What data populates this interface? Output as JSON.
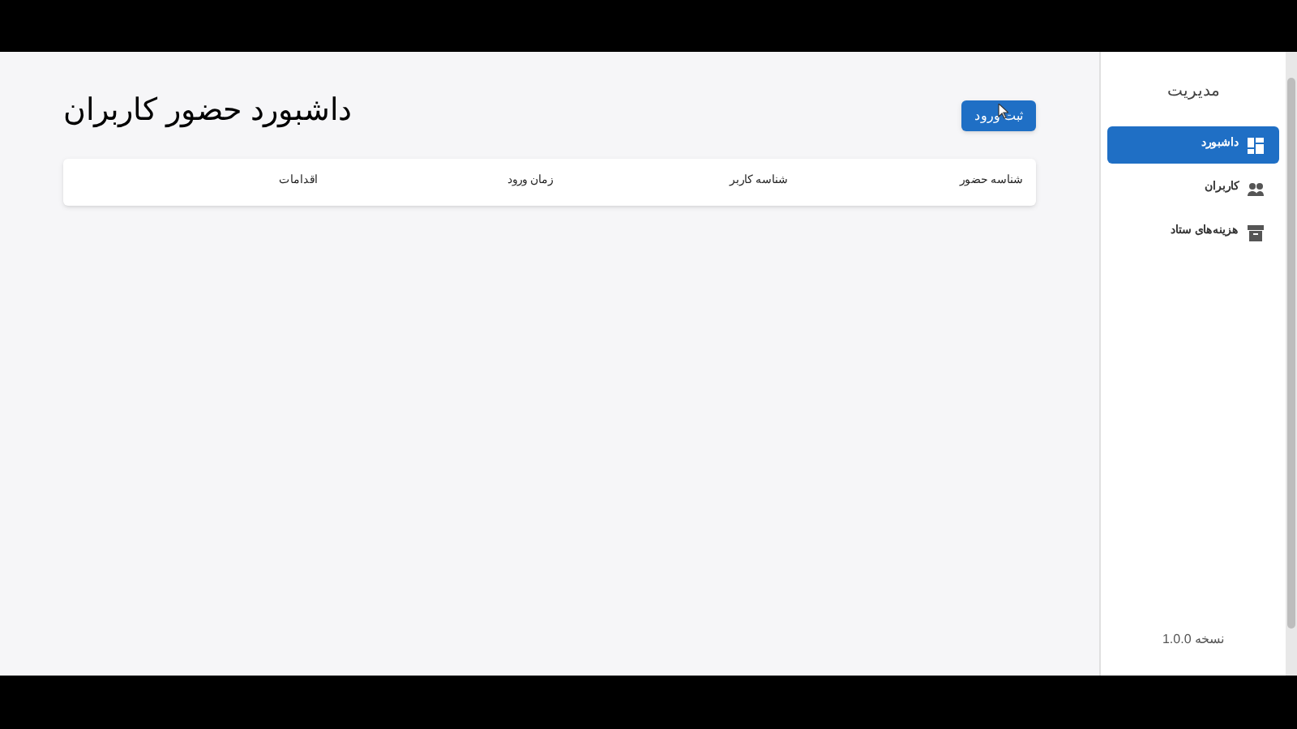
{
  "header": {
    "title": "داشبورد حضور کاربران",
    "button": "ثبت ورود"
  },
  "table": {
    "columns": [
      "شناسه حضور",
      "شناسه کاربر",
      "زمان ورود",
      "اقدامات"
    ]
  },
  "sidebar": {
    "title": "مدیریت",
    "items": [
      {
        "label": "داشبورد",
        "kind": "dashboard",
        "selected": true
      },
      {
        "label": "کاربران",
        "kind": "users",
        "selected": false
      },
      {
        "label": "هزینه‌های ستاد",
        "kind": "archive",
        "selected": false
      }
    ],
    "version": "نسخه 1.0.0"
  }
}
